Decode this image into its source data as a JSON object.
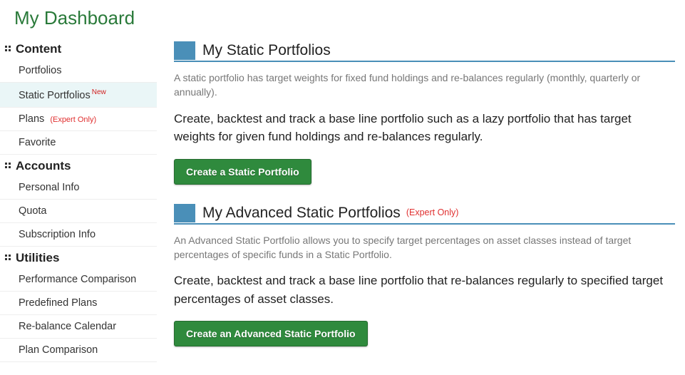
{
  "pageTitle": "My Dashboard",
  "sidebar": {
    "sections": [
      {
        "label": "Content",
        "items": [
          {
            "label": "Portfolios",
            "badge": "",
            "expert": ""
          },
          {
            "label": "Static Portfolios",
            "badge": "New",
            "expert": ""
          },
          {
            "label": "Plans",
            "badge": "",
            "expert": "(Expert Only)"
          },
          {
            "label": "Favorite",
            "badge": "",
            "expert": ""
          }
        ]
      },
      {
        "label": "Accounts",
        "items": [
          {
            "label": "Personal Info",
            "badge": "",
            "expert": ""
          },
          {
            "label": "Quota",
            "badge": "",
            "expert": ""
          },
          {
            "label": "Subscription Info",
            "badge": "",
            "expert": ""
          }
        ]
      },
      {
        "label": "Utilities",
        "items": [
          {
            "label": "Performance Comparison",
            "badge": "",
            "expert": ""
          },
          {
            "label": "Predefined Plans",
            "badge": "",
            "expert": ""
          },
          {
            "label": "Re-balance Calendar",
            "badge": "",
            "expert": ""
          },
          {
            "label": "Plan Comparison",
            "badge": "",
            "expert": ""
          }
        ]
      }
    ]
  },
  "panels": [
    {
      "title": "My Static Portfolios",
      "expert": "",
      "desc": "A static portfolio has target weights for fixed fund holdings and re-balances regularly (monthly, quarterly or annually).",
      "lead": "Create, backtest and track a base line portfolio such as a lazy portfolio that has target weights for given fund holdings and re-balances regularly.",
      "button": "Create a Static Portfolio"
    },
    {
      "title": "My Advanced Static Portfolios",
      "expert": "(Expert Only)",
      "desc": "An Advanced Static Portfolio allows you to specify target percentages on asset classes instead of target percentages of specific funds in a Static Portfolio.",
      "lead": "Create, backtest and track a base line portfolio that re-balances regularly to specified target percentages of asset classes.",
      "button": "Create an Advanced Static Portfolio"
    }
  ]
}
